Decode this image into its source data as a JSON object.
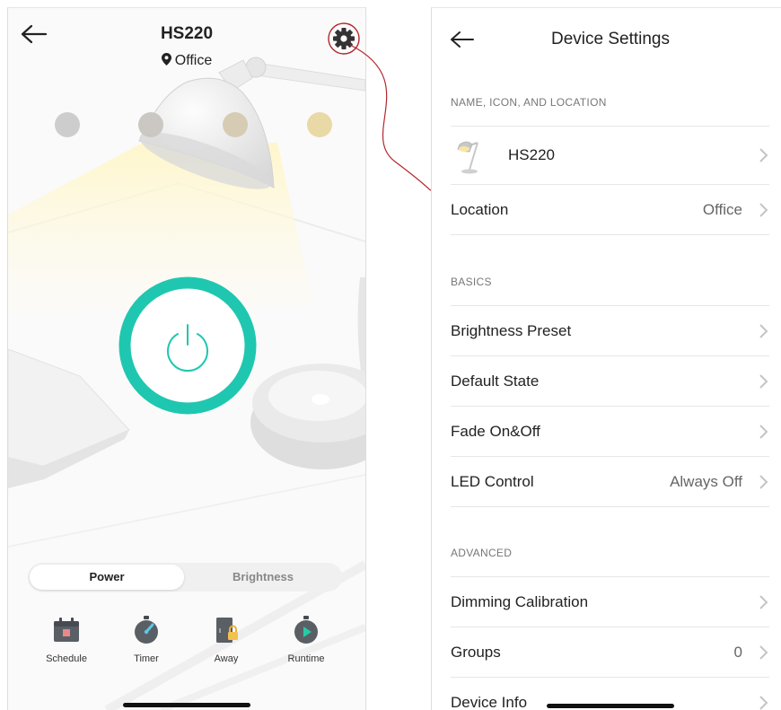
{
  "left": {
    "device_name": "HS220",
    "location": "Office",
    "brightness_presets": [
      "#cdcdcd",
      "#cbc8c4",
      "#d6ccb4",
      "#e8d9a6"
    ],
    "power_ring_color": "#1fc7b0",
    "tabs": [
      {
        "label": "Power",
        "active": true
      },
      {
        "label": "Brightness",
        "active": false
      }
    ],
    "features": [
      {
        "label": "Schedule",
        "icon": "calendar-icon"
      },
      {
        "label": "Timer",
        "icon": "stopwatch-icon"
      },
      {
        "label": "Away",
        "icon": "door-lock-icon"
      },
      {
        "label": "Runtime",
        "icon": "play-clock-icon"
      }
    ]
  },
  "connector_color": "#b3262b",
  "right": {
    "title": "Device Settings",
    "sections": {
      "name_icon_location": "NAME, ICON, AND LOCATION",
      "basics": "BASICS",
      "advanced": "ADVANCED"
    },
    "rows": {
      "device": {
        "label": "HS220"
      },
      "location": {
        "label": "Location",
        "value": "Office"
      },
      "brightness_preset": {
        "label": "Brightness Preset"
      },
      "default_state": {
        "label": "Default State"
      },
      "fade": {
        "label": "Fade On&Off"
      },
      "led_control": {
        "label": "LED Control",
        "value": "Always Off"
      },
      "dimming_calibration": {
        "label": "Dimming Calibration"
      },
      "groups": {
        "label": "Groups",
        "value": "0"
      },
      "device_info": {
        "label": "Device Info"
      }
    }
  }
}
